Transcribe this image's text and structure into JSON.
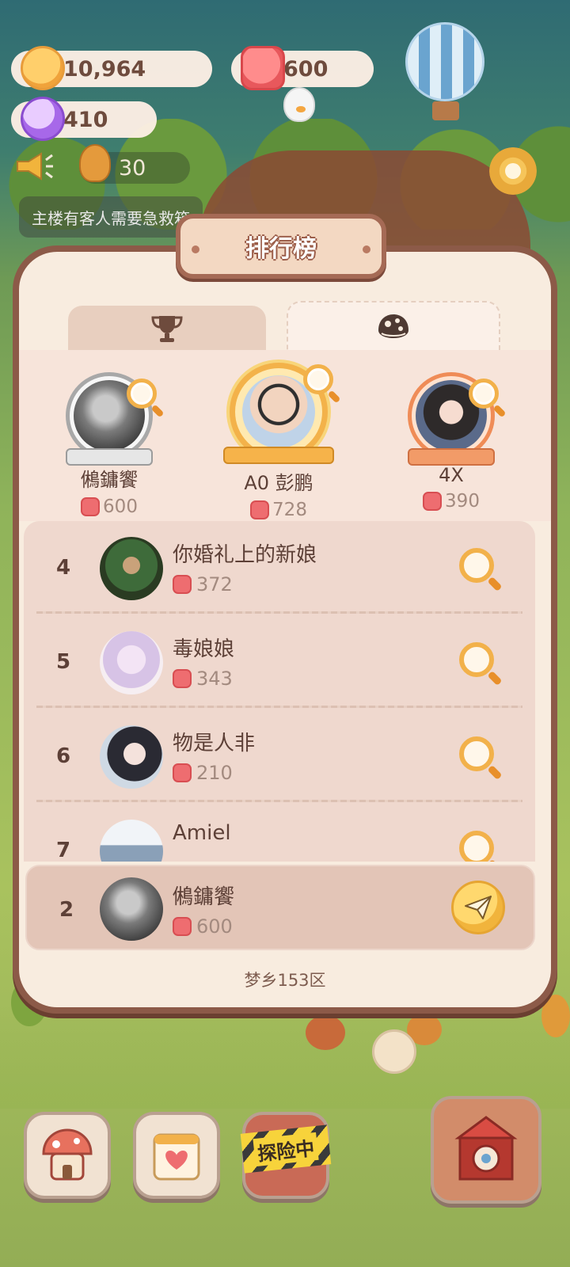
{
  "hud": {
    "cookie_coins": "10,964",
    "jelly": "600",
    "gems": "410",
    "tickets": "30",
    "notice": "主楼有客人需要急救箱"
  },
  "modal": {
    "title": "排行榜",
    "tabs": [
      {
        "icon": "trophy-icon",
        "active": false
      },
      {
        "icon": "cookie-icon",
        "active": true
      }
    ],
    "podium": [
      {
        "rank": 2,
        "name": "鵂鏞饗",
        "score": "600",
        "frame": "silver"
      },
      {
        "rank": 1,
        "name": "A0  彭鹏",
        "score": "728",
        "frame": "gold"
      },
      {
        "rank": 3,
        "name": "4X",
        "score": "390",
        "frame": "bronze"
      }
    ],
    "list": [
      {
        "rank": "4",
        "name": "你婚礼上的新娘",
        "score": "372"
      },
      {
        "rank": "5",
        "name": "毒娘娘",
        "score": "343"
      },
      {
        "rank": "6",
        "name": "物是人非",
        "score": "210"
      },
      {
        "rank": "7",
        "name": "Amiel",
        "score": ""
      }
    ],
    "self": {
      "rank": "2",
      "name": "鵂鏞饗",
      "score": "600"
    },
    "server": "梦乡153区"
  },
  "bottom_bar": {
    "explore_label": "探险中"
  },
  "colors": {
    "modal_border": "#8c5a48",
    "modal_bg": "#f8ecdf",
    "list_bg": "#efd8ce",
    "accent_gold": "#f2b14a",
    "jelly_red": "#ee6d70"
  }
}
